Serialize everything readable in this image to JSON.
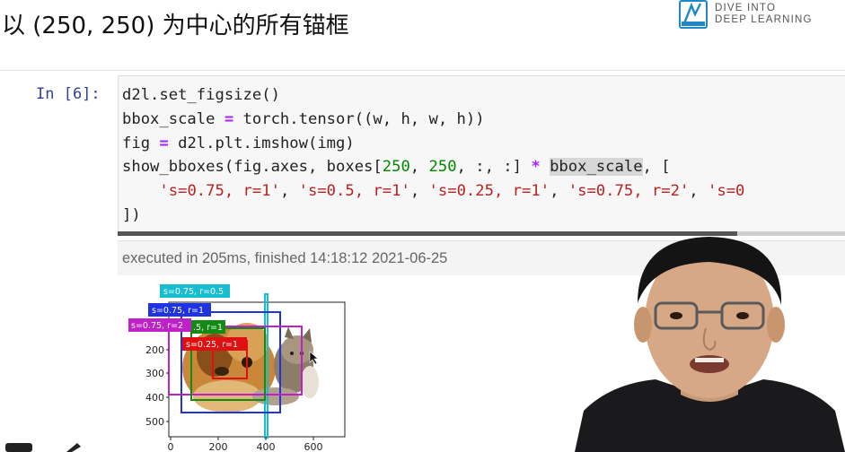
{
  "slide": {
    "title": "以 (250, 250) 为中心的所有锚框",
    "logo_line1": "DIVE INTO",
    "logo_line2": "DEEP LEARNING"
  },
  "notebook": {
    "prompt": "In [6]:",
    "code_lines": [
      "d2l.set_figsize()",
      "bbox_scale = torch.tensor((w, h, w, h))",
      "fig = d2l.plt.imshow(img)",
      "show_bboxes(fig.axes, boxes[250, 250, :, :] * bbox_scale, [",
      "    's=0.75, r=1', 's=0.5, r=1', 's=0.25, r=1', 's=0.75, r=2', 's=0",
      "])"
    ],
    "execution_info": "executed in 205ms, finished 14:18:12 2021-06-25"
  },
  "chart_data": {
    "type": "image-with-boxes",
    "y_ticks": [
      "200",
      "300",
      "400",
      "500"
    ],
    "x_ticks": [
      "0",
      "200",
      "400",
      "600"
    ],
    "boxes": [
      {
        "label": "s=0.75, r=0.5",
        "color": "#17becf"
      },
      {
        "label": "s=0.75, r=1",
        "color": "#1f33e0"
      },
      {
        "label": "s=0.75, r=2",
        "color": "#c020c8"
      },
      {
        "label": "s=0.5, r=1",
        "color": "#138a13"
      },
      {
        "label": "s=0.25, r=1",
        "color": "#e01010"
      }
    ],
    "visible_label_texts": [
      "s=0.75, r=0.5",
      "s=0.75, r=1",
      "s=0.75, r=2",
      ".5, r=1",
      "s=0.25, r=1"
    ]
  },
  "colors": {
    "prompt": "#303f9f",
    "operator": "#aa22ff",
    "number": "#008800",
    "string": "#ba2121"
  }
}
